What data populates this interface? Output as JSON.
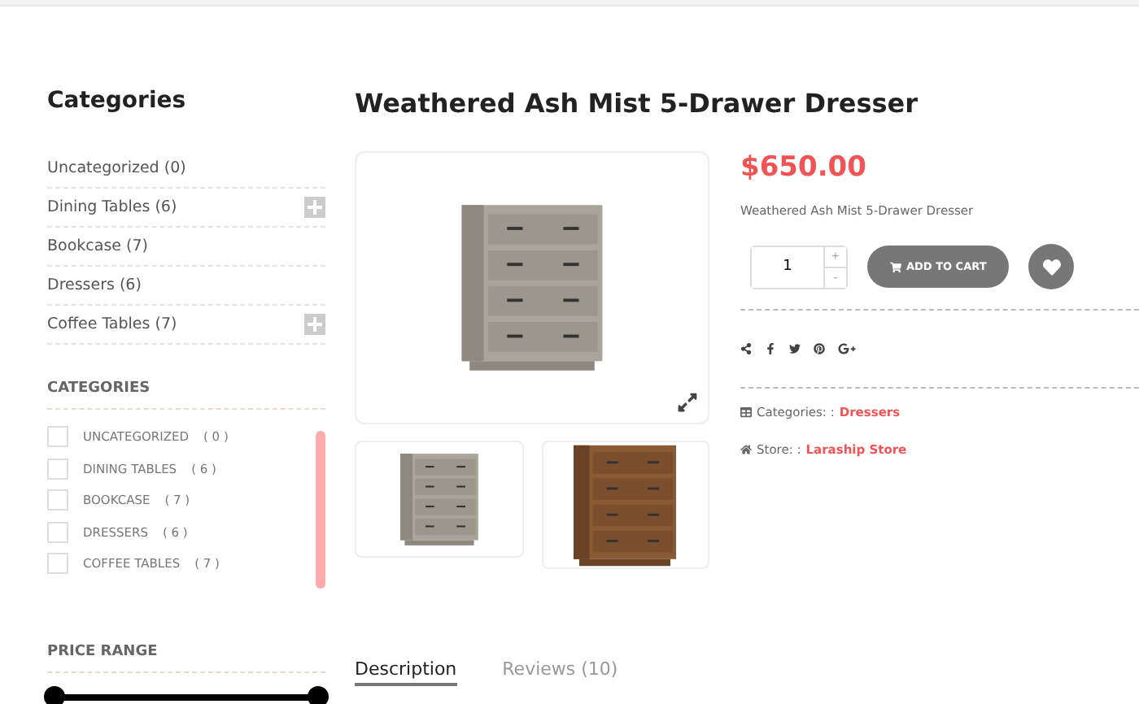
{
  "sidebar": {
    "title": "Categories",
    "categories": [
      {
        "label": "Uncategorized (0)",
        "expandable": false
      },
      {
        "label": "Dining Tables (6)",
        "expandable": true
      },
      {
        "label": "Bookcase (7)",
        "expandable": false
      },
      {
        "label": "Dressers (6)",
        "expandable": false
      },
      {
        "label": "Coffee Tables (7)",
        "expandable": true
      }
    ],
    "filter_title": "CATEGORIES",
    "filters": [
      {
        "label": "UNCATEGORIZED",
        "count": "( 0 )",
        "checked": false
      },
      {
        "label": "DINING TABLES",
        "count": "( 6 )",
        "checked": false
      },
      {
        "label": "BOOKCASE",
        "count": "( 7 )",
        "checked": false
      },
      {
        "label": "DRESSERS",
        "count": "( 6 )",
        "checked": false
      },
      {
        "label": "COFFEE TABLES",
        "count": "( 7 )",
        "checked": false
      }
    ],
    "price_title": "PRICE RANGE"
  },
  "product": {
    "title": "Weathered Ash Mist 5-Drawer Dresser",
    "price": "$650.00",
    "description": "Weathered Ash Mist 5-Drawer Dresser",
    "quantity": "1",
    "plus": "+",
    "minus": "-",
    "add_to_cart": "ADD TO CART",
    "thumbnails": [
      {
        "kind": "grey"
      },
      {
        "kind": "brown"
      }
    ],
    "meta": [
      {
        "kind": "category",
        "label": "Categories: :",
        "link": "Dressers"
      },
      {
        "kind": "store",
        "label": "Store: :",
        "link": "Laraship Store"
      }
    ]
  },
  "tabs": [
    {
      "label": "Description",
      "selected": true
    },
    {
      "label": "Reviews (10)",
      "selected": false
    }
  ]
}
